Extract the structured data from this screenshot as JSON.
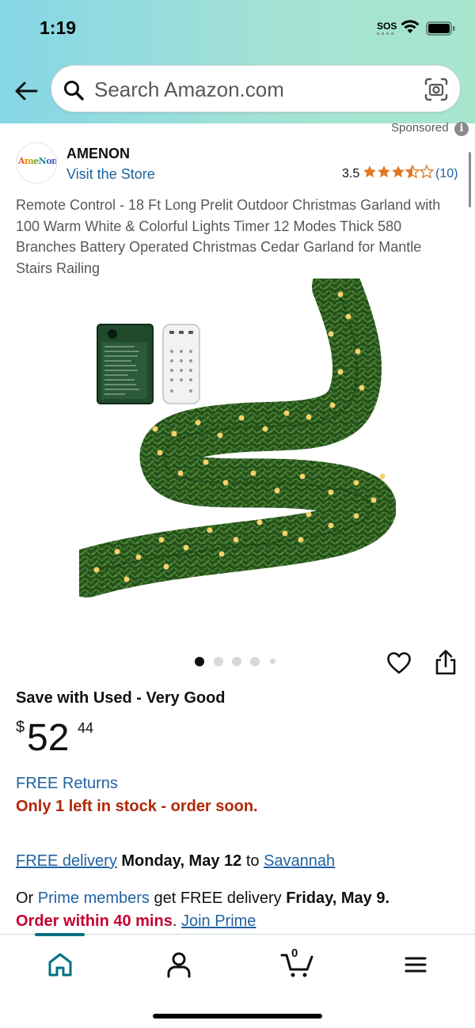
{
  "status_bar": {
    "time": "1:19",
    "sos": "SOS"
  },
  "search": {
    "placeholder": "Search Amazon.com"
  },
  "icons": {
    "back": "arrow-left-icon",
    "search": "magnifier-icon",
    "camera": "camera-lens-icon",
    "heart": "heart-icon",
    "share": "share-icon",
    "home": "home-icon",
    "account": "person-icon",
    "cart": "cart-icon",
    "menu": "hamburger-icon"
  },
  "sponsored": {
    "label": "Sponsored"
  },
  "brand": {
    "logo_text": "AmeNon",
    "name": "AMENON",
    "visit_store": "Visit the Store",
    "rating": "3.5",
    "rating_fraction": 0.7,
    "review_count": "(10)"
  },
  "product": {
    "title": "Remote Control - 18 Ft Long Prelit Outdoor Christmas Garland with 100 Warm White & Colorful Lights Timer 12 Modes Thick 580 Branches Battery Operated Christmas Cedar Garland for Mantle Stairs Railing",
    "image_count": 5,
    "active_image": 0
  },
  "offer": {
    "save_title": "Save with Used - Very Good",
    "price_symbol": "$",
    "price_whole": "52",
    "price_fraction": "44",
    "free_returns": "FREE Returns",
    "stock": "Only 1 left in stock - order soon."
  },
  "delivery": {
    "free_delivery_link": "FREE delivery",
    "date": "Monday, May 12",
    "to_word": "to",
    "location_link": "Savannah",
    "or_word": "Or",
    "prime_members": "Prime members",
    "prime_text": "get FREE delivery",
    "prime_date": "Friday, May 9.",
    "order_within": "Order within 40 mins",
    "join_prime": "Join Prime"
  },
  "bottom_nav": {
    "cart_count": "0"
  },
  "colors": {
    "link": "#2162a1",
    "stock_red": "#b12704",
    "urgency_red": "#c40233",
    "star": "#de7921",
    "nav_accent": "#007185"
  }
}
